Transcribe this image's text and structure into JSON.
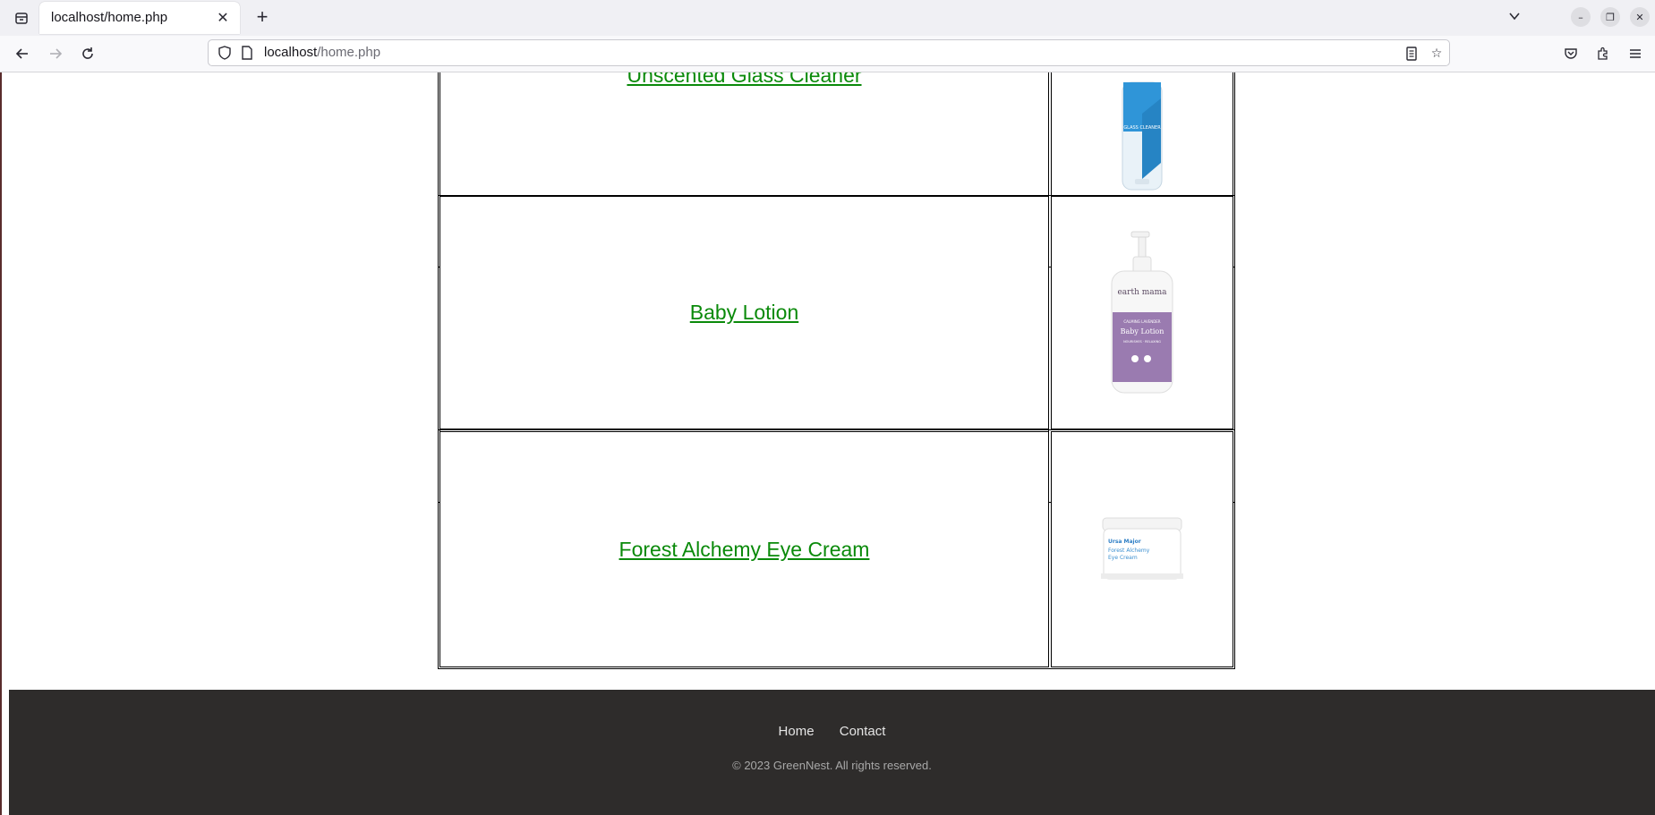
{
  "browser": {
    "tab_title": "localhost/home.php",
    "url_host": "localhost",
    "url_path": "/home.php"
  },
  "products": [
    {
      "name": "Unscented Glass Cleaner",
      "image_icon": "glass-cleaner-bottle"
    },
    {
      "name": "Baby Lotion",
      "image_icon": "baby-lotion-pump-bottle"
    },
    {
      "name": "Forest Alchemy Eye Cream",
      "image_icon": "eye-cream-jar"
    }
  ],
  "product_labels": {
    "glass_cleaner_brand": "GLASS CLEANER",
    "lotion_brand": "earth mama",
    "lotion_subtitle": "CALMING LAVENDER",
    "lotion_name": "Baby Lotion",
    "lotion_tagline": "NOURISHES · RELAXING",
    "cream_brand": "Ursa Major",
    "cream_name_line1": "Forest Alchemy",
    "cream_name_line2": "Eye Cream"
  },
  "footer": {
    "nav": [
      "Home",
      "Contact"
    ],
    "copyright": "© 2023 GreenNest. All rights reserved."
  }
}
